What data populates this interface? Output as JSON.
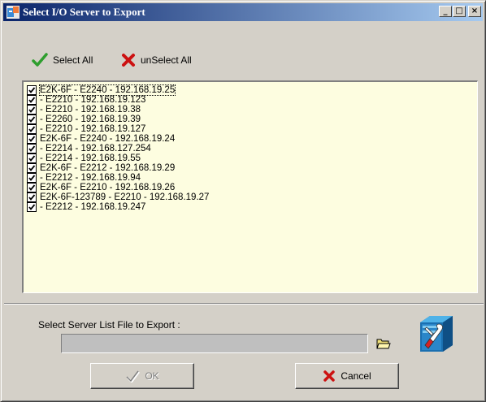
{
  "window": {
    "title": "Select I/O Server to Export",
    "minimize_label": "_",
    "maximize_label": "□",
    "close_label": "×"
  },
  "actions": {
    "select_all": "Select All",
    "unselect_all": "unSelect All"
  },
  "servers": [
    {
      "label": "E2K-6F - E2240 - 192.168.19.25",
      "checked": true
    },
    {
      "label": " - E2210 - 192.168.19.123",
      "checked": true
    },
    {
      "label": " - E2210 - 192.168.19.38",
      "checked": true
    },
    {
      "label": " - E2260 - 192.168.19.39",
      "checked": true
    },
    {
      "label": " - E2210 - 192.168.19.127",
      "checked": true
    },
    {
      "label": "E2K-6F - E2240 - 192.168.19.24",
      "checked": true
    },
    {
      "label": " - E2214 - 192.168.127.254",
      "checked": true
    },
    {
      "label": " - E2214 - 192.168.19.55",
      "checked": true
    },
    {
      "label": "E2K-6F - E2212 - 192.168.19.29",
      "checked": true
    },
    {
      "label": " - E2212 - 192.168.19.94",
      "checked": true
    },
    {
      "label": "E2K-6F - E2210 - 192.168.19.26",
      "checked": true
    },
    {
      "label": "E2K-6F-123789 - E2210 - 192.168.19.27",
      "checked": true
    },
    {
      "label": " - E2212 - 192.168.19.247",
      "checked": true
    }
  ],
  "export": {
    "label": "Select Server List File to Export :",
    "file_value": ""
  },
  "buttons": {
    "ok": "OK",
    "cancel": "Cancel"
  },
  "colors": {
    "list_bg": "#fdfde0",
    "title_start": "#0a246a",
    "title_end": "#a6caf0",
    "check_green": "#2e9e2e",
    "cross_red": "#cc1111"
  }
}
